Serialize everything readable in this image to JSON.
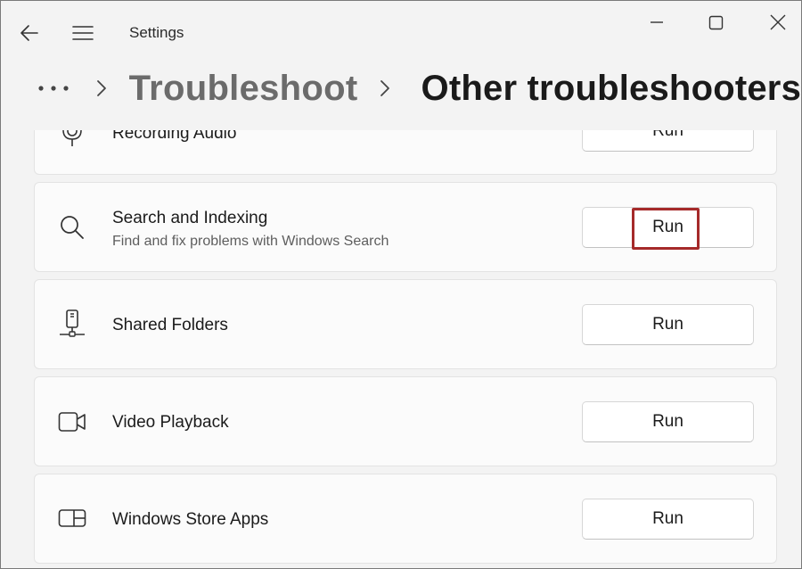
{
  "window": {
    "title": "Settings"
  },
  "breadcrumb": {
    "more": "•••",
    "parent": "Troubleshoot",
    "current": "Other troubleshooters"
  },
  "troubleshooters": [
    {
      "title": "Recording Audio",
      "description": "",
      "icon": "microphone-icon",
      "button": "Run"
    },
    {
      "title": "Search and Indexing",
      "description": "Find and fix problems with Windows Search",
      "icon": "search-icon",
      "button": "Run",
      "highlighted": true
    },
    {
      "title": "Shared Folders",
      "description": "",
      "icon": "network-drive-icon",
      "button": "Run"
    },
    {
      "title": "Video Playback",
      "description": "",
      "icon": "video-camera-icon",
      "button": "Run"
    },
    {
      "title": "Windows Store Apps",
      "description": "",
      "icon": "store-app-icon",
      "button": "Run"
    }
  ],
  "colors": {
    "highlight_box": "#a52a2a",
    "background": "#f3f3f3",
    "card": "#fbfbfb"
  }
}
